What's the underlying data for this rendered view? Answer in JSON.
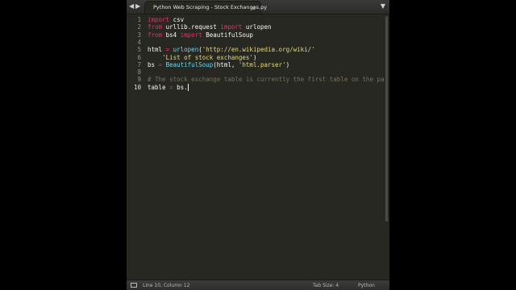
{
  "window": {
    "tab_title": "Python Web Scraping - Stock Exchanges.py",
    "nav_left": "◀",
    "nav_right": "▶",
    "tab_menu": "▼"
  },
  "editor": {
    "line_numbers": [
      "1",
      "2",
      "3",
      "4",
      "5",
      "6",
      "7",
      "8",
      "9",
      "10"
    ],
    "active_line": 10,
    "lines": [
      [
        {
          "t": "import",
          "c": "kw"
        },
        {
          "t": " csv",
          "c": ""
        }
      ],
      [
        {
          "t": "from",
          "c": "kw"
        },
        {
          "t": " urllib.request ",
          "c": ""
        },
        {
          "t": "import",
          "c": "kw"
        },
        {
          "t": " urlopen",
          "c": ""
        }
      ],
      [
        {
          "t": "from",
          "c": "kw"
        },
        {
          "t": " bs4 ",
          "c": ""
        },
        {
          "t": "import",
          "c": "kw"
        },
        {
          "t": " BeautifulSoup",
          "c": ""
        }
      ],
      [],
      [
        {
          "t": "html ",
          "c": ""
        },
        {
          "t": "=",
          "c": "kw"
        },
        {
          "t": " ",
          "c": ""
        },
        {
          "t": "urlopen",
          "c": "fn"
        },
        {
          "t": "(",
          "c": ""
        },
        {
          "t": "'http://en.wikipedia.org/wiki/'",
          "c": "str"
        }
      ],
      [
        {
          "t": "    ",
          "c": ""
        },
        {
          "t": "'List of stock exchanges'",
          "c": "str"
        },
        {
          "t": ")",
          "c": ""
        }
      ],
      [
        {
          "t": "bs ",
          "c": ""
        },
        {
          "t": "=",
          "c": "kw"
        },
        {
          "t": " ",
          "c": ""
        },
        {
          "t": "BeautifulSoup",
          "c": "fn"
        },
        {
          "t": "(html, ",
          "c": ""
        },
        {
          "t": "'html.parser'",
          "c": "str"
        },
        {
          "t": ")",
          "c": ""
        }
      ],
      [],
      [
        {
          "t": "# The stock exchange table is currently the first table on the pa",
          "c": "cm"
        }
      ],
      [
        {
          "t": "table ",
          "c": ""
        },
        {
          "t": "=",
          "c": "kw"
        },
        {
          "t": " bs.",
          "c": ""
        }
      ]
    ]
  },
  "status": {
    "position": "Line 10, Column 12",
    "tab_size": "Tab Size: 4",
    "syntax": "Python"
  },
  "colors": {
    "background": "#272822",
    "keyword": "#f92672",
    "string": "#e6db74",
    "function": "#66d9ef",
    "comment": "#75715e",
    "text": "#f8f8f2"
  }
}
